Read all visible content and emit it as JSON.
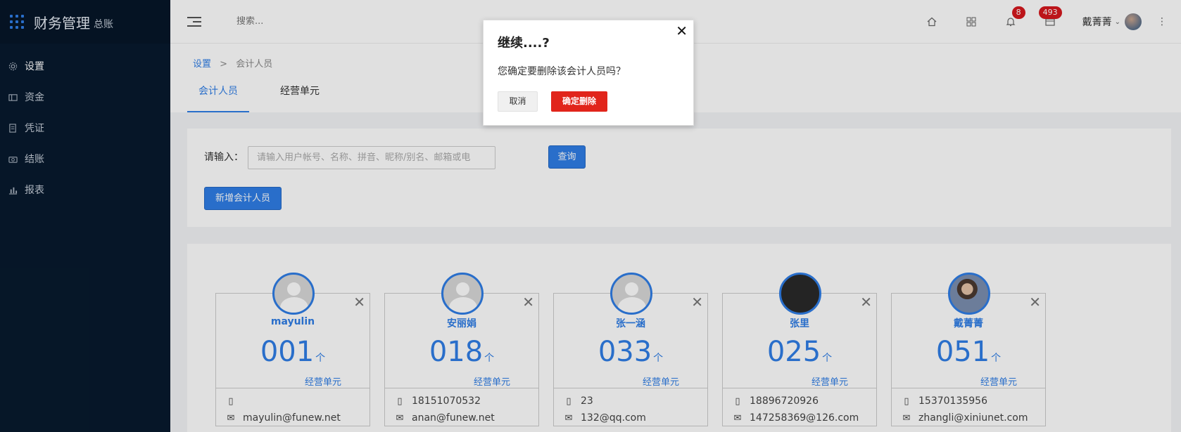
{
  "sidebar": {
    "brand_title": "财务管理",
    "brand_sub": "总账",
    "items": [
      {
        "label": "设置",
        "icon": "gear-icon"
      },
      {
        "label": "资金",
        "icon": "money-icon"
      },
      {
        "label": "凭证",
        "icon": "voucher-icon"
      },
      {
        "label": "结账",
        "icon": "checkout-icon"
      },
      {
        "label": "报表",
        "icon": "report-icon"
      }
    ]
  },
  "topbar": {
    "search_placeholder": "搜索...",
    "notifications_count": "8",
    "messages_count": "493",
    "user_name": "戴菁菁"
  },
  "breadcrumb": {
    "root": "设置",
    "separator": ">",
    "current": "会计人员"
  },
  "tabs": [
    {
      "label": "会计人员"
    },
    {
      "label": "经营单元"
    }
  ],
  "filter": {
    "label": "请输入：",
    "placeholder": "请输入用户帐号、名称、拼音、昵称/别名、邮箱或电",
    "query_button": "查询",
    "add_button": "新增会计人员"
  },
  "cards": [
    {
      "name": "mayulin",
      "count": "001",
      "unit": "个",
      "unit_label": "经营单元",
      "phone": "",
      "email": "mayulin@funew.net",
      "avatar": "default"
    },
    {
      "name": "安丽娟",
      "count": "018",
      "unit": "个",
      "unit_label": "经营单元",
      "phone": "18151070532",
      "email": "anan@funew.net",
      "avatar": "default"
    },
    {
      "name": "张一涵",
      "count": "033",
      "unit": "个",
      "unit_label": "经营单元",
      "phone": "23",
      "email": "132@qq.com",
      "avatar": "default"
    },
    {
      "name": "张里",
      "count": "025",
      "unit": "个",
      "unit_label": "经营单元",
      "phone": "18896720926",
      "email": "147258369@126.com",
      "avatar": "dark"
    },
    {
      "name": "戴菁菁",
      "count": "051",
      "unit": "个",
      "unit_label": "经营单元",
      "phone": "15370135956",
      "email": "zhangli@xiniunet.com",
      "avatar": "photo"
    }
  ],
  "modal": {
    "title": "继续....?",
    "message": "您确定要删除该会计人员吗？",
    "cancel_label": "取消",
    "confirm_label": "确定删除"
  },
  "colors": {
    "sidebar_bg": "#071a2e",
    "accent": "#2f7ee6",
    "danger": "#e1251b",
    "badge": "#d7191e"
  }
}
